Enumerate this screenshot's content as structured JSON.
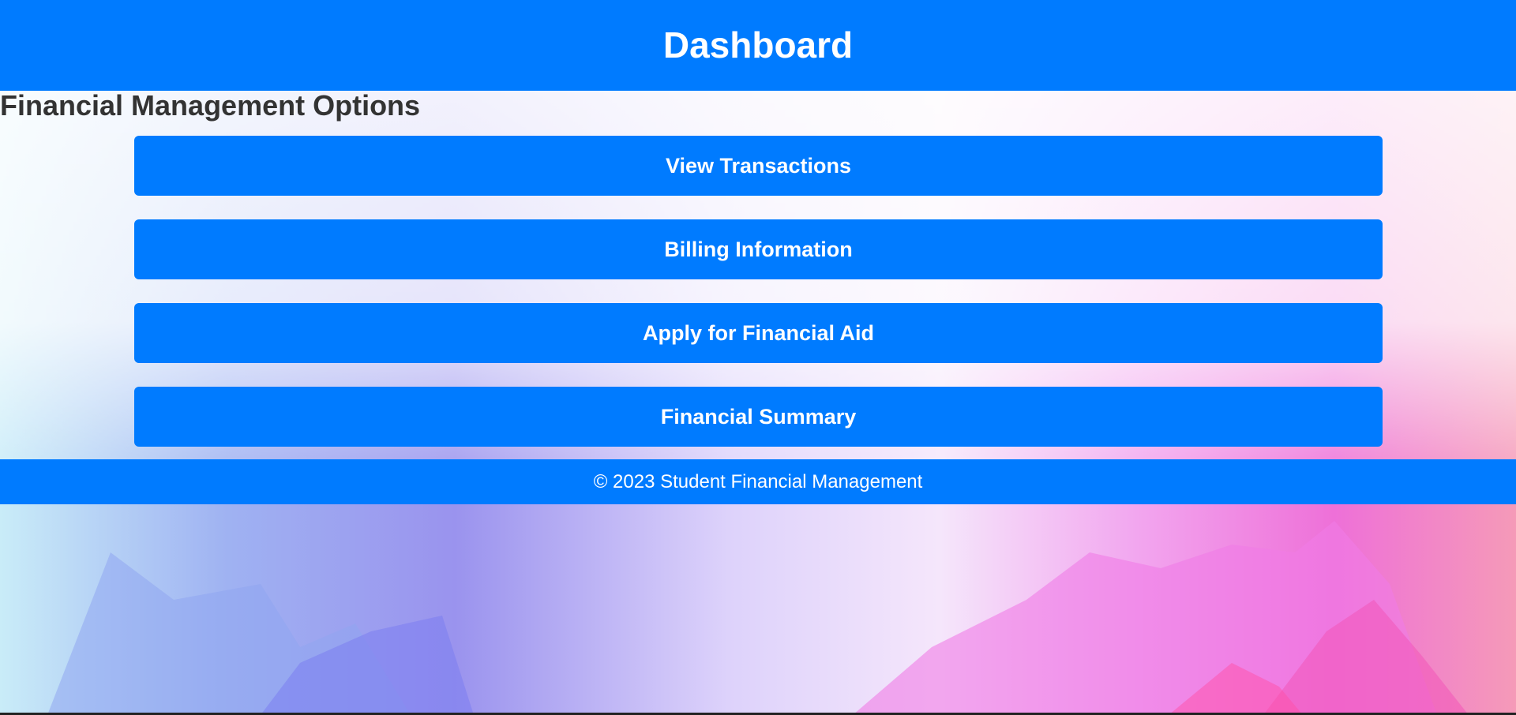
{
  "header": {
    "title": "Dashboard"
  },
  "section": {
    "title": "Financial Management Options"
  },
  "options": [
    {
      "label": "View Transactions"
    },
    {
      "label": "Billing Information"
    },
    {
      "label": "Apply for Financial Aid"
    },
    {
      "label": "Financial Summary"
    }
  ],
  "footer": {
    "text": "© 2023 Student Financial Management"
  },
  "colors": {
    "primary": "#007bff",
    "heading_text": "#333333"
  }
}
